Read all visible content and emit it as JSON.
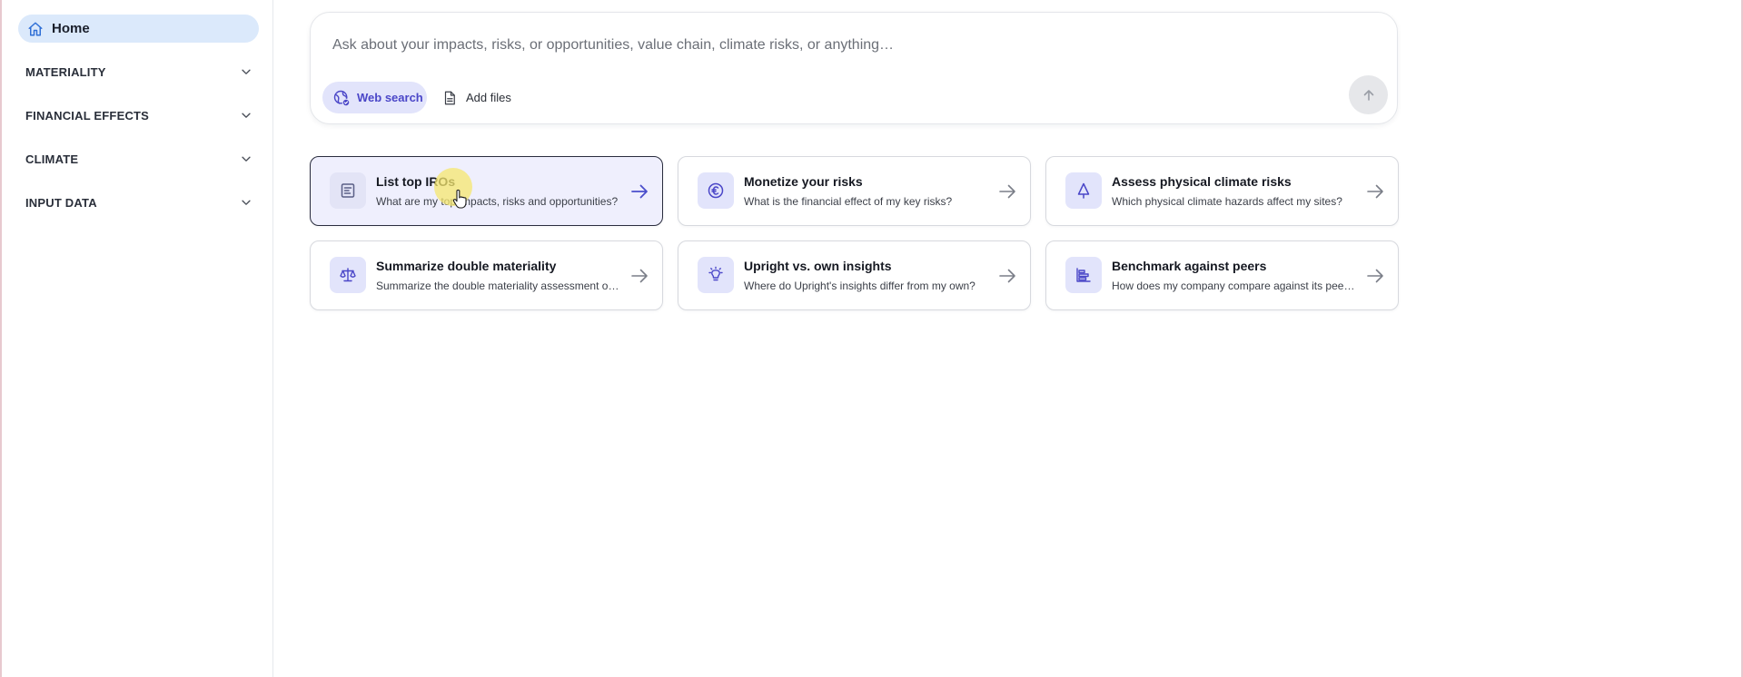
{
  "sidebar": {
    "home_label": "Home",
    "sections": [
      {
        "label": "MATERIALITY"
      },
      {
        "label": "FINANCIAL EFFECTS"
      },
      {
        "label": "CLIMATE"
      },
      {
        "label": "INPUT DATA"
      }
    ]
  },
  "composer": {
    "placeholder": "Ask about your impacts, risks, or opportunities, value chain, climate risks, or anything…",
    "web_search_label": "Web search",
    "add_files_label": "Add files"
  },
  "cards": [
    {
      "title": "List top IROs",
      "subtitle": "What are my top impacts, risks and opportunities?",
      "icon": "document-list-icon",
      "active": true
    },
    {
      "title": "Monetize your risks",
      "subtitle": "What is the financial effect of my key risks?",
      "icon": "euro-coin-icon",
      "active": false
    },
    {
      "title": "Assess physical climate risks",
      "subtitle": "Which physical climate hazards affect my sites?",
      "icon": "tree-icon",
      "active": false
    },
    {
      "title": "Summarize double materiality",
      "subtitle": "Summarize the double materiality assessment of my company",
      "icon": "scales-icon",
      "active": false
    },
    {
      "title": "Upright vs. own insights",
      "subtitle": "Where do Upright's insights differ from my own?",
      "icon": "lightbulb-icon",
      "active": false
    },
    {
      "title": "Benchmark against peers",
      "subtitle": "How does my company compare against its peers?",
      "icon": "bar-chart-icon",
      "active": false
    }
  ],
  "colors": {
    "accent": "#4a46c8",
    "accent_bg": "#e2e4fb",
    "home_bg": "#dbe9fb"
  }
}
